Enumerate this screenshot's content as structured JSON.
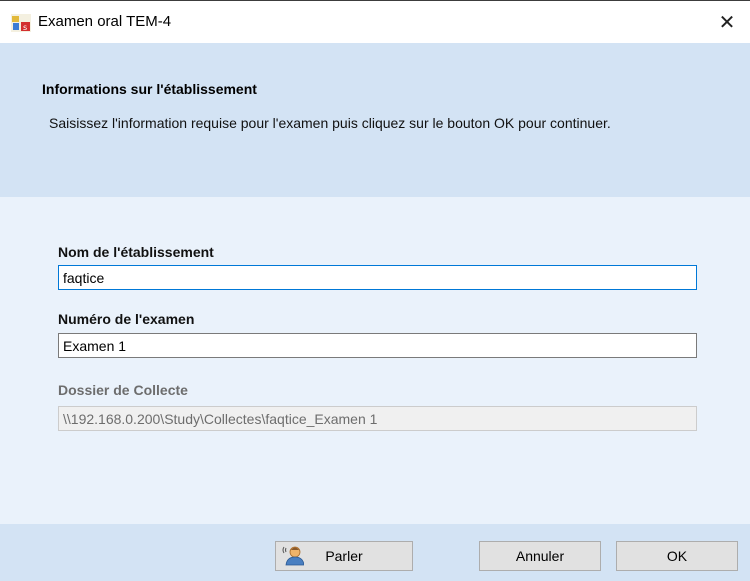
{
  "window": {
    "title": "Examen oral TEM-4",
    "icon": "tem-app-icon",
    "close_glyph": "✕"
  },
  "header": {
    "title": "Informations sur l'établissement",
    "description": "Saisissez l'information requise pour l'examen puis cliquez sur le bouton OK pour continuer."
  },
  "form": {
    "institution_label": "Nom de l'établissement",
    "institution_value": "faqtice",
    "exam_label": "Numéro de l'examen",
    "exam_value": "Examen 1",
    "folder_label": "Dossier de Collecte",
    "folder_value": "\\\\192.168.0.200\\Study\\Collectes\\faqtice_Examen 1"
  },
  "buttons": {
    "speak_label": "Parler",
    "speak_icon": "speaker-person-icon",
    "cancel_label": "Annuler",
    "ok_label": "OK"
  },
  "colors": {
    "band": "#d3e3f4",
    "body": "#eaf2fb",
    "focus_border": "#0078d7"
  }
}
